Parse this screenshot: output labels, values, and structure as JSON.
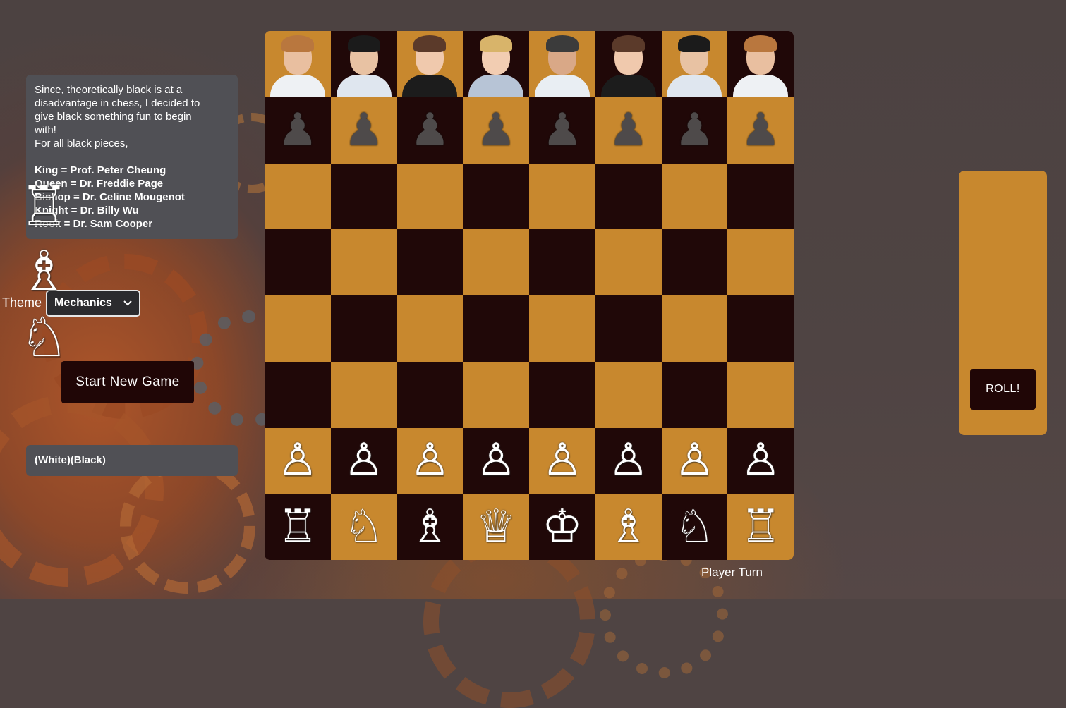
{
  "info": {
    "lines": [
      "Since, theoretically black is at a",
      "disadvantage in chess, I decided to",
      "give black something fun to begin",
      "with!",
      "For all black pieces,"
    ],
    "assignments": [
      "King = Prof. Peter Cheung",
      "Queen = Dr. Freddie Page",
      "Bishop = Dr. Celine Mougenot",
      "Knight = Dr. Billy Wu",
      "Rook = Dr. Sam Cooper"
    ]
  },
  "theme": {
    "label": "Theme",
    "selected": "Mechanics",
    "icon": "chevron-down-icon"
  },
  "start_button": "Start New Game",
  "turn_log": "(White)(Black)",
  "player_turn": "Player Turn",
  "roll_button": "ROLL!",
  "promotion_options": [
    {
      "name": "rook",
      "glyph": "♖"
    },
    {
      "name": "bishop",
      "glyph": "♗"
    },
    {
      "name": "knight",
      "glyph": "♘"
    }
  ],
  "colors": {
    "light_square": "#c8882e",
    "dark_square": "#200808",
    "panel": "#505055",
    "button": "#200606"
  },
  "board": {
    "black_back_rank": [
      {
        "piece": "rook",
        "represents": "Dr. Sam Cooper",
        "skin": "#e9bfa0",
        "hair": "#b9773e",
        "shirt": "#eef1f4"
      },
      {
        "piece": "knight",
        "represents": "Dr. Billy Wu",
        "skin": "#e8c2a3",
        "hair": "#1b1b1b",
        "shirt": "#dfe6ef"
      },
      {
        "piece": "bishop",
        "represents": "Dr. Celine Mougenot",
        "skin": "#f0c9ad",
        "hair": "#5b3a2a",
        "shirt": "#1c1c1c"
      },
      {
        "piece": "queen",
        "represents": "Dr. Freddie Page",
        "skin": "#f2cdb2",
        "hair": "#d8b46a",
        "shirt": "#b7c4d6"
      },
      {
        "piece": "king",
        "represents": "Prof. Peter Cheung",
        "skin": "#d9a887",
        "hair": "#3b3b3b",
        "shirt": "#e9eef3"
      },
      {
        "piece": "bishop",
        "represents": "Dr. Celine Mougenot",
        "skin": "#f0c9ad",
        "hair": "#5b3a2a",
        "shirt": "#1c1c1c"
      },
      {
        "piece": "knight",
        "represents": "Dr. Billy Wu",
        "skin": "#e8c2a3",
        "hair": "#1b1b1b",
        "shirt": "#dfe6ef"
      },
      {
        "piece": "rook",
        "represents": "Dr. Sam Cooper",
        "skin": "#e9bfa0",
        "hair": "#b9773e",
        "shirt": "#eef1f4"
      }
    ],
    "ranks": [
      [
        "portrait",
        "portrait",
        "portrait",
        "portrait",
        "portrait",
        "portrait",
        "portrait",
        "portrait"
      ],
      [
        "♟",
        "♟",
        "♟",
        "♟",
        "♟",
        "♟",
        "♟",
        "♟"
      ],
      [
        "",
        "",
        "",
        "",
        "",
        "",
        "",
        ""
      ],
      [
        "",
        "",
        "",
        "",
        "",
        "",
        "",
        ""
      ],
      [
        "",
        "",
        "",
        "",
        "",
        "",
        "",
        ""
      ],
      [
        "",
        "",
        "",
        "",
        "",
        "",
        "",
        ""
      ],
      [
        "♙",
        "♙",
        "♙",
        "♙",
        "♙",
        "♙",
        "♙",
        "♙"
      ],
      [
        "♖",
        "♘",
        "♗",
        "♕",
        "♔",
        "♗",
        "♘",
        "♖"
      ]
    ],
    "piece_names": {
      "♟": "black-pawn",
      "♙": "white-pawn",
      "♖": "white-rook",
      "♘": "white-knight",
      "♗": "white-bishop",
      "♕": "white-queen",
      "♔": "white-king"
    }
  }
}
